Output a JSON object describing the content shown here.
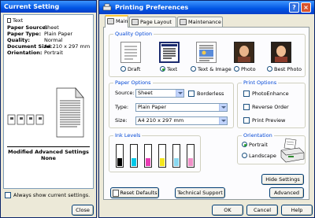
{
  "current_setting": {
    "title": "Current Setting",
    "text_title": "Text",
    "rows": [
      {
        "key": "Paper Source:",
        "value": "Sheet"
      },
      {
        "key": "Paper Type:",
        "value": "Plain Paper"
      },
      {
        "key": "Quality:",
        "value": "Normal"
      },
      {
        "key": "Document Size:",
        "value": "A4 210 x 297 mm"
      },
      {
        "key": "Orientation:",
        "value": "Portrait"
      }
    ],
    "modified_label": "Modified Advanced Settings",
    "modified_value": "None",
    "always_show_label": "Always show current settings.",
    "always_show_checked": false,
    "close_label": "Close"
  },
  "preferences": {
    "title": "Printing Preferences",
    "tabs": [
      {
        "label": "Main",
        "active": true
      },
      {
        "label": "Page Layout",
        "active": false
      },
      {
        "label": "Maintenance",
        "active": false
      }
    ],
    "quality_option": {
      "title": "Quality Option",
      "options": [
        {
          "label": "Draft",
          "selected": false
        },
        {
          "label": "Text",
          "selected": true
        },
        {
          "label": "Text & Image",
          "selected": false
        },
        {
          "label": "Photo",
          "selected": false
        },
        {
          "label": "Best Photo",
          "selected": false
        }
      ]
    },
    "paper_options": {
      "title": "Paper Options",
      "source_label": "Source:",
      "source_value": "Sheet",
      "borderless_label": "Borderless",
      "borderless_checked": false,
      "type_label": "Type:",
      "type_value": "Plain Paper",
      "size_label": "Size:",
      "size_value": "A4 210 x 297 mm"
    },
    "print_options": {
      "title": "Print Options",
      "items": [
        {
          "label": "PhotoEnhance",
          "checked": false
        },
        {
          "label": "Reverse Order",
          "checked": false
        },
        {
          "label": "Print Preview",
          "checked": false
        }
      ]
    },
    "ink_levels": {
      "title": "Ink Levels",
      "colors": [
        "#000000",
        "#00c8e8",
        "#e83cb4",
        "#f5e61e",
        "#8ad8f0",
        "#f090c8"
      ],
      "levels": [
        0.35,
        0.35,
        0.35,
        0.35,
        0.35,
        0.35
      ]
    },
    "orientation": {
      "title": "Orientation",
      "options": [
        {
          "label": "Portrait",
          "selected": true
        },
        {
          "label": "Landscape",
          "selected": false
        }
      ]
    },
    "buttons": {
      "hide_settings": "Hide Settings",
      "reset_defaults": "Reset Defaults",
      "technical_support": "Technical Support",
      "advanced": "Advanced",
      "ok": "OK",
      "cancel": "Cancel",
      "help": "Help"
    },
    "titlebar_help": "?",
    "titlebar_close": "×"
  }
}
